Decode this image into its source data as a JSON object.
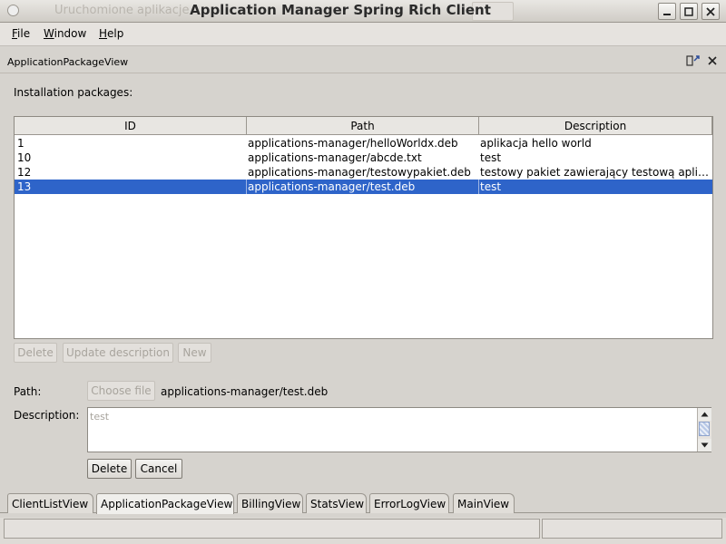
{
  "window": {
    "title": "Application Manager Spring Rich Client",
    "ghost_title": "Uruchomione aplikacje"
  },
  "menu": {
    "items": [
      {
        "label": "File",
        "mnemonic": "F",
        "rest": "ile"
      },
      {
        "label": "Window",
        "mnemonic": "W",
        "rest": "indow"
      },
      {
        "label": "Help",
        "mnemonic": "H",
        "rest": "elp"
      }
    ]
  },
  "view": {
    "title": "ApplicationPackageView",
    "packages_label": "Installation packages:"
  },
  "table": {
    "columns": [
      "ID",
      "Path",
      "Description"
    ],
    "rows": [
      {
        "id": "1",
        "path": "applications-manager/helloWorldx.deb",
        "description": "aplikacja hello world"
      },
      {
        "id": "10",
        "path": "applications-manager/abcde.txt",
        "description": "test"
      },
      {
        "id": "12",
        "path": "applications-manager/testowypakiet.deb",
        "description": "testowy pakiet zawierający testową aplik..."
      },
      {
        "id": "13",
        "path": "applications-manager/test.deb",
        "description": "test"
      }
    ],
    "selected_index": 3
  },
  "actions": {
    "delete": "Delete",
    "update_description": "Update description",
    "new": "New"
  },
  "form": {
    "path_label": "Path:",
    "choose_file": "Choose file",
    "path_value": "applications-manager/test.deb",
    "description_label": "Description:",
    "description_value": "test",
    "delete": "Delete",
    "cancel": "Cancel"
  },
  "tabs": [
    {
      "label": "ClientListView"
    },
    {
      "label": "ApplicationPackageView",
      "active": true
    },
    {
      "label": "BillingView"
    },
    {
      "label": "StatsView"
    },
    {
      "label": "ErrorLogView"
    },
    {
      "label": "MainView"
    }
  ],
  "colors": {
    "selection": "#2e64c9",
    "window_bg": "#d6d3ce"
  }
}
